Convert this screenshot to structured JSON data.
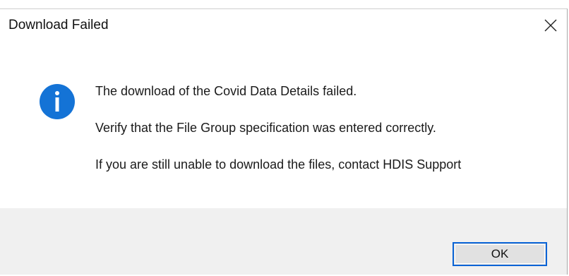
{
  "dialog": {
    "title": "Download Failed",
    "close_label": "×",
    "icon": "info-icon",
    "messages": [
      "The download of the Covid Data Details failed.",
      "Verify that the File Group specification was entered correctly.",
      "If you are still unable to download the files, contact HDIS Support"
    ],
    "ok_label": "OK"
  },
  "colors": {
    "accent": "#0a64d6",
    "info_icon": "#1473d6",
    "footer_bg": "#f0f0f0",
    "button_bg": "#e1e1e1"
  }
}
